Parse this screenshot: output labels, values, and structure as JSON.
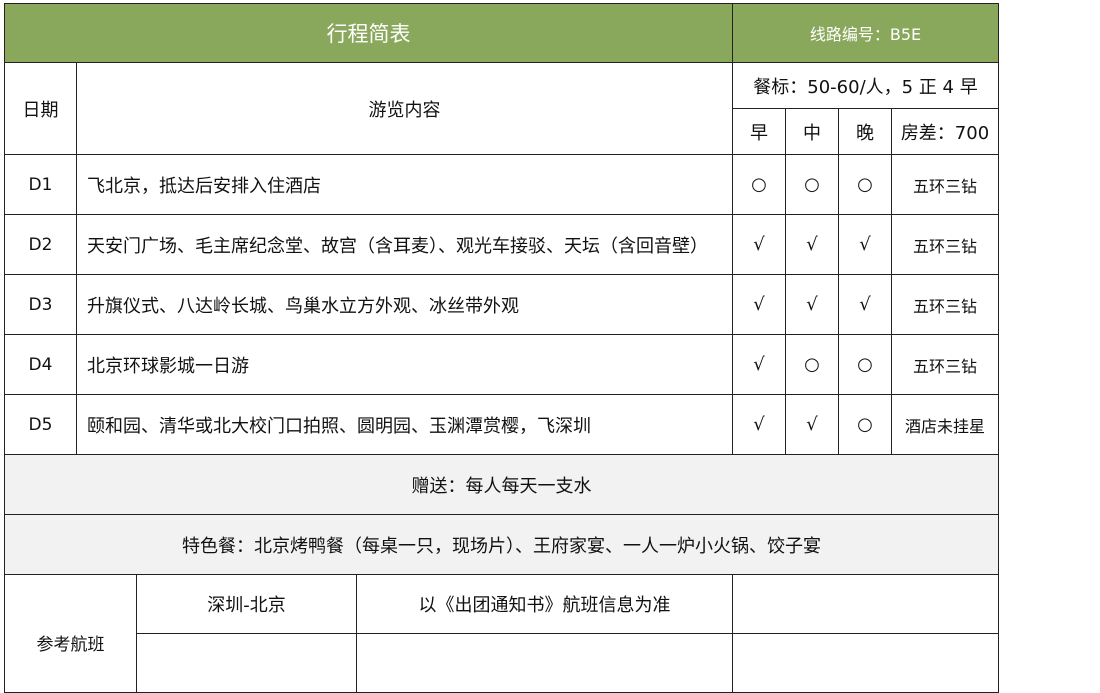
{
  "header": {
    "title": "行程简表",
    "route_code": "线路编号：B5E"
  },
  "columns": {
    "date": "日期",
    "content": "游览内容",
    "meal_standard": "餐标：50-60/人，5 正 4 早",
    "breakfast": "早",
    "lunch": "中",
    "dinner": "晚",
    "room_diff": "房差：700"
  },
  "days": [
    {
      "day": "D1",
      "content": "飞北京，抵达后安排入住酒店",
      "breakfast": "○",
      "lunch": "○",
      "dinner": "○",
      "hotel": "五环三钻"
    },
    {
      "day": "D2",
      "content": "天安门广场、毛主席纪念堂、故宫（含耳麦）、观光车接驳、天坛（含回音壁）",
      "breakfast": "√",
      "lunch": "√",
      "dinner": "√",
      "hotel": "五环三钻"
    },
    {
      "day": "D3",
      "content": "升旗仪式、八达岭长城、鸟巢水立方外观、冰丝带外观",
      "breakfast": "√",
      "lunch": "√",
      "dinner": "√",
      "hotel": "五环三钻"
    },
    {
      "day": "D4",
      "content": "北京环球影城一日游",
      "breakfast": "√",
      "lunch": "○",
      "dinner": "○",
      "hotel": "五环三钻"
    },
    {
      "day": "D5",
      "content": "颐和园、清华或北大校门口拍照、圆明园、玉渊潭赏樱，飞深圳",
      "breakfast": "√",
      "lunch": "√",
      "dinner": "○",
      "hotel": "酒店未挂星"
    }
  ],
  "gift": "赠送：每人每天一支水",
  "special_meals": "特色餐：北京烤鸭餐（每桌一只，现场片）、王府家宴、一人一炉小火锅、饺子宴",
  "flights": {
    "label": "参考航班",
    "route": "深圳-北京",
    "note": "以《出团通知书》航班信息为准",
    "extra": ""
  }
}
